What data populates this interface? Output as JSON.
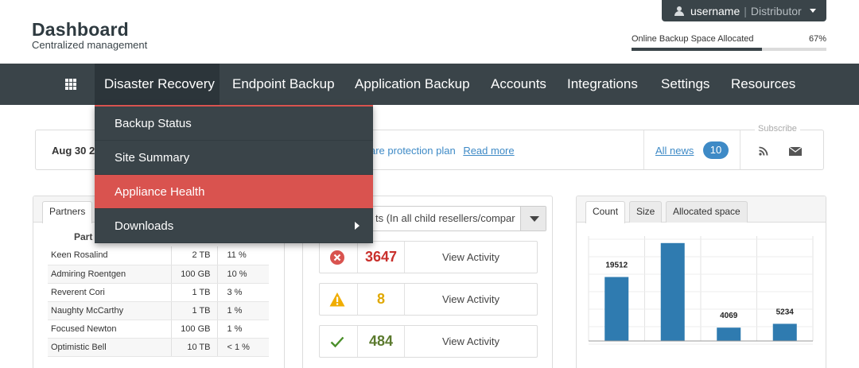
{
  "header": {
    "title": "Dashboard",
    "subtitle": "Centralized management",
    "user": {
      "name": "username",
      "role": "Distributor"
    },
    "backup_space": {
      "label": "Online Backup Space Allocated",
      "percent_text": "67%",
      "fraction": 0.67
    }
  },
  "nav": {
    "items": [
      "Disaster Recovery",
      "Endpoint Backup",
      "Application Backup",
      "Accounts",
      "Integrations",
      "Settings",
      "Resources"
    ],
    "active_index": 0
  },
  "dropdown": {
    "items": [
      "Backup Status",
      "Site Summary",
      "Appliance Health",
      "Downloads"
    ],
    "highlighted_index": 2
  },
  "news": {
    "date": "Aug 30 20",
    "text": "are protection plan",
    "read_more": "Read more",
    "all_news": "All news",
    "count": "10",
    "subscribe_label": "Subscribe"
  },
  "partners_panel": {
    "tabs": [
      "Partners"
    ],
    "column_header": "Part",
    "rows": [
      {
        "name": "Keen Rosalind",
        "size": "2 TB",
        "pct": "11 %"
      },
      {
        "name": "Admiring Roentgen",
        "size": "100 GB",
        "pct": "10 %"
      },
      {
        "name": "Reverent Cori",
        "size": "1 TB",
        "pct": "3 %"
      },
      {
        "name": "Naughty McCarthy",
        "size": "1 TB",
        "pct": "1 %"
      },
      {
        "name": "Focused Newton",
        "size": "100 GB",
        "pct": "1 %"
      },
      {
        "name": "Optimistic Bell",
        "size": "10 TB",
        "pct": "< 1 %"
      }
    ]
  },
  "activity_panel": {
    "select_value": "ts (In all child resellers/compar",
    "items": [
      {
        "icon": "error-icon",
        "count": "3647",
        "label": "View Activity",
        "color": "#c9302c"
      },
      {
        "icon": "warning-icon",
        "count": "8",
        "label": "View Activity",
        "color": "#e0a800"
      },
      {
        "icon": "check-icon",
        "count": "484",
        "label": "View Activity",
        "color": "#5b7a2e"
      }
    ]
  },
  "chart_panel": {
    "tabs": [
      "Count",
      "Size",
      "Allocated space"
    ],
    "active_tab": 0
  },
  "chart_data": {
    "type": "bar",
    "title": "",
    "categories": [
      "",
      "",
      "",
      ""
    ],
    "values": [
      19512,
      29865,
      4069,
      5234
    ],
    "ylim": [
      0,
      32000
    ],
    "grid": true,
    "color": "#2f7bb0"
  }
}
